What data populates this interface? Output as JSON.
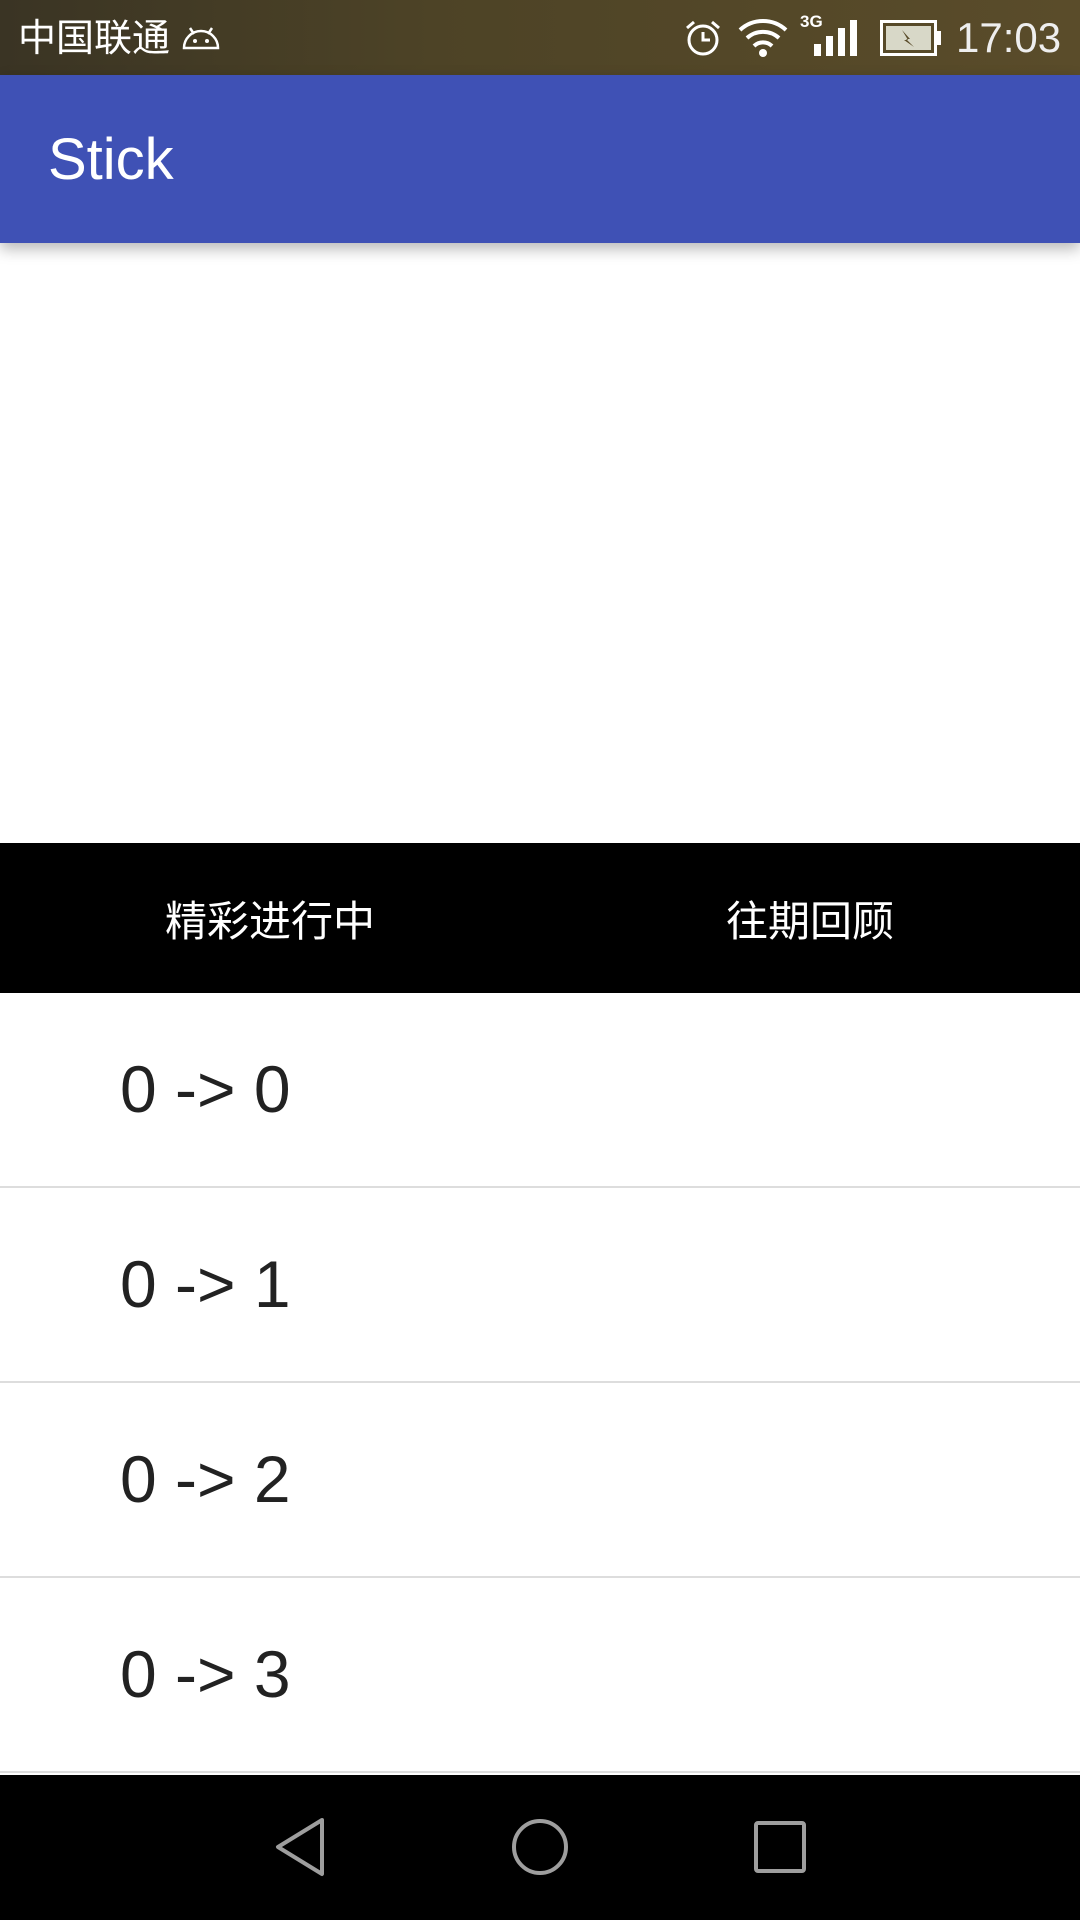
{
  "status_bar": {
    "carrier": "中国联通",
    "network_type": "3G",
    "time": "17:03",
    "icons": [
      "android-icon",
      "alarm-icon",
      "wifi-icon",
      "signal-icon",
      "battery-charging-icon"
    ]
  },
  "app_bar": {
    "title": "Stick",
    "color": "#3f51b5"
  },
  "tabs": [
    {
      "label": "精彩进行中"
    },
    {
      "label": "往期回顾"
    }
  ],
  "list": {
    "items": [
      {
        "text": "0 -> 0"
      },
      {
        "text": "0 -> 1"
      },
      {
        "text": "0 -> 2"
      },
      {
        "text": "0 -> 3"
      }
    ]
  },
  "nav_bar": {
    "buttons": [
      "back-icon",
      "home-icon",
      "recents-icon"
    ]
  }
}
